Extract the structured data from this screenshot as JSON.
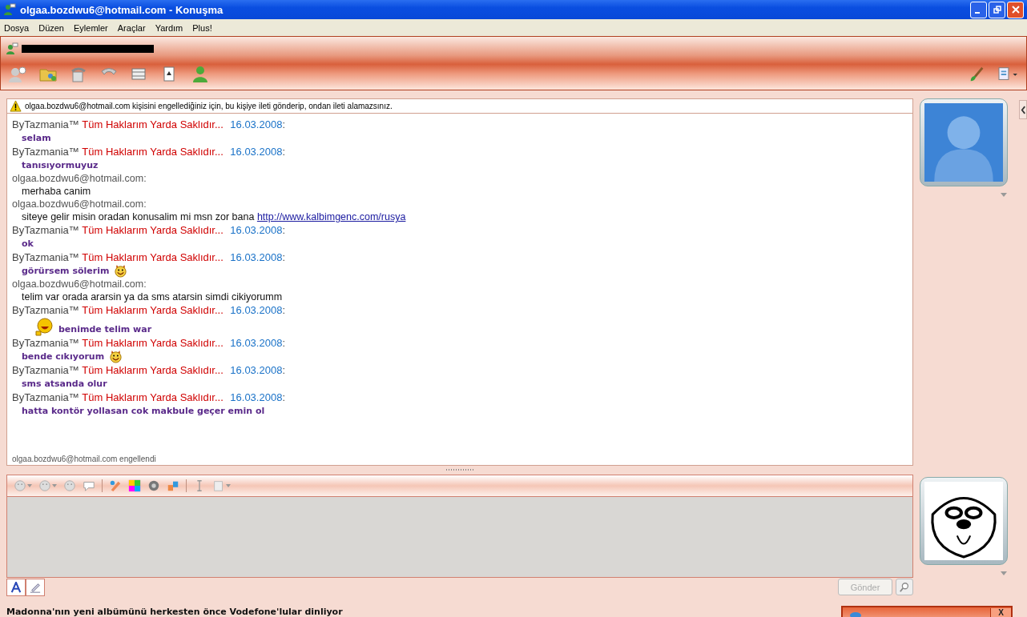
{
  "window": {
    "title": "olgaa.bozdwu6@hotmail.com - Konuşma"
  },
  "menu": [
    "Dosya",
    "Düzen",
    "Eylemler",
    "Araçlar",
    "Yardım",
    "Plus!"
  ],
  "notice": "olgaa.bozdwu6@hotmail.com kişisini engellediğiniz için, bu kişiye ileti gönderip, ondan ileti alamazsınız.",
  "messages": [
    {
      "kind": "self",
      "name": "ByTazmania™",
      "status": "Tüm Haklarım Yarda Saklıdır...",
      "date": "16.03.2008",
      "colon": ":",
      "text": "selam"
    },
    {
      "kind": "self",
      "name": "ByTazmania™",
      "status": "Tüm Haklarım Yarda Saklıdır...",
      "date": "16.03.2008",
      "colon": ":",
      "text": "tanısıyormuyuz"
    },
    {
      "kind": "contact",
      "sender": "olgaa.bozdwu6@hotmail.com:",
      "text": "merhaba canim"
    },
    {
      "kind": "contact",
      "sender": "olgaa.bozdwu6@hotmail.com:",
      "text": "siteye gelir misin oradan konusalim mi msn zor bana",
      "link": "http://www.kalbimgenc.com/rusya"
    },
    {
      "kind": "self",
      "name": "ByTazmania™",
      "status": "Tüm Haklarım Yarda Saklıdır...",
      "date": "16.03.2008",
      "colon": ":",
      "text": "ok"
    },
    {
      "kind": "self",
      "name": "ByTazmania™",
      "status": "Tüm Haklarım Yarda Saklıdır...",
      "date": "16.03.2008",
      "colon": ":",
      "parts": [
        {
          "kind": "text",
          "text": "görürsem sölerim"
        },
        {
          "kind": "devil_emoticon"
        }
      ]
    },
    {
      "kind": "contact",
      "sender": "olgaa.bozdwu6@hotmail.com:",
      "text": "telim var orada ararsin ya da sms atarsin simdi cikiyorumm"
    },
    {
      "kind": "self",
      "name": "ByTazmania™",
      "status": "Tüm Haklarım Yarda Saklıdır...",
      "date": "16.03.2008",
      "colon": ":",
      "parts": [
        {
          "kind": "laughing_emoticon"
        },
        {
          "kind": "text",
          "text": "benimde telim war"
        }
      ]
    },
    {
      "kind": "self",
      "name": "ByTazmania™",
      "status": "Tüm Haklarım Yarda Saklıdır...",
      "date": "16.03.2008",
      "colon": ":",
      "parts": [
        {
          "kind": "text",
          "text": "bende cıkıyorum"
        },
        {
          "kind": "devil_emoticon"
        }
      ]
    },
    {
      "kind": "self",
      "name": "ByTazmania™",
      "status": "Tüm Haklarım Yarda Saklıdır...",
      "date": "16.03.2008",
      "colon": ":",
      "text": "sms atsanda olur"
    },
    {
      "kind": "self",
      "name": "ByTazmania™",
      "status": "Tüm Haklarım Yarda Saklıdır...",
      "date": "16.03.2008",
      "colon": ":",
      "text": "hatta kontör yollasan cok makbule geçer emin ol"
    }
  ],
  "status_line": "olgaa.bozdwu6@hotmail.com engellendi",
  "send_button": {
    "label": "Gönder",
    "disabled": true
  },
  "ad": "Madonna'nın yeni albümünü herkesten önce Vodefone'lular dinliyor",
  "popup": {
    "close": "X"
  }
}
